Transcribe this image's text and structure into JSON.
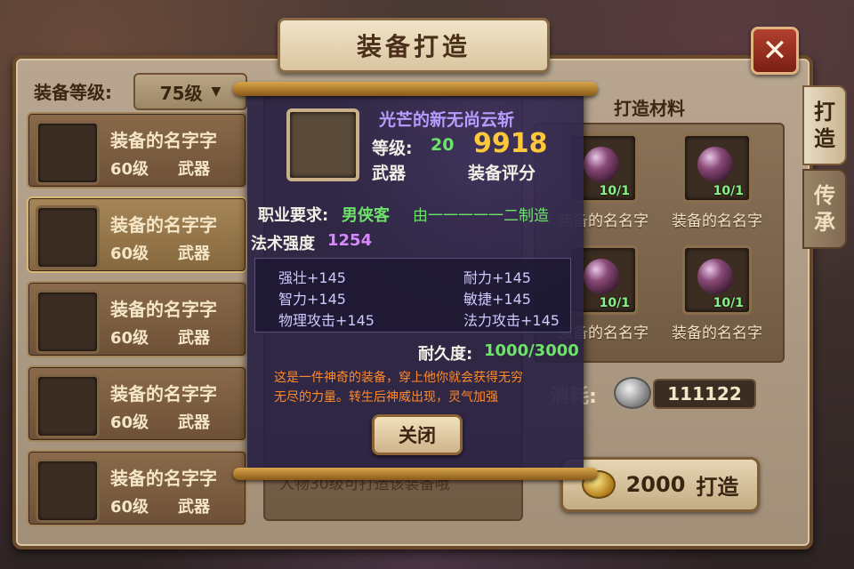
{
  "window": {
    "title": "装备打造",
    "close_glyph": "✕"
  },
  "tabs": [
    {
      "label_l1": "打",
      "label_l2": "造"
    },
    {
      "label_l1": "传",
      "label_l2": "承"
    }
  ],
  "filter": {
    "label": "装备等级:",
    "selected": "75级",
    "caret": "▼"
  },
  "list": [
    {
      "name": "装备的名字字",
      "level": "60级",
      "type": "武器"
    },
    {
      "name": "装备的名字字",
      "level": "60级",
      "type": "武器"
    },
    {
      "name": "装备的名字字",
      "level": "60级",
      "type": "武器"
    },
    {
      "name": "装备的名字字",
      "level": "60级",
      "type": "武器"
    },
    {
      "name": "装备的名字字",
      "level": "60级",
      "type": "武器"
    }
  ],
  "mid": {
    "bottom_text": "人物30级可打造该装备哦"
  },
  "materials": {
    "title": "打造材料",
    "items": [
      {
        "count": "10/1",
        "name": "装备的名名字"
      },
      {
        "count": "10/1",
        "name": "装备的名名字"
      },
      {
        "count": "10/1",
        "name": "装备的名名字"
      },
      {
        "count": "10/1",
        "name": "装备的名名字"
      }
    ]
  },
  "cost": {
    "label": "消耗:",
    "value": "111122"
  },
  "forge": {
    "amount": "2000",
    "label": "打造"
  },
  "tooltip": {
    "name": "光芒的新无尚云斩",
    "level_label": "等级:",
    "level_value": "20",
    "score": "9918",
    "type": "武器",
    "score_label": "装备评分",
    "req_label": "职业要求:",
    "req_value": "男侠客",
    "maker": "由一一一一一二制造",
    "magic_label": "法术强度",
    "magic_value": "1254",
    "stats": [
      "强壮+145",
      "耐力+145",
      "智力+145",
      "敏捷+145",
      "物理攻击+145",
      "法力攻击+145"
    ],
    "durability_label": "耐久度:",
    "durability_value": "1000/3000",
    "desc_l1": "这是一件神奇的装备，穿上他你就会获得无穷",
    "desc_l2": "无尽的力量。转生后神威出现，灵气加强",
    "close_label": "关闭"
  }
}
